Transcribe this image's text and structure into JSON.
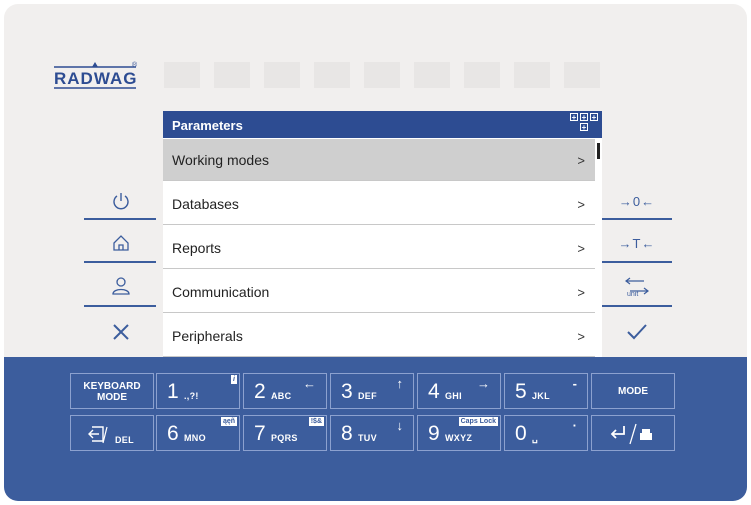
{
  "brand": {
    "logo_text": "RADWAG",
    "registered": "®"
  },
  "screen": {
    "title": "Parameters",
    "items": [
      {
        "label": "Working modes",
        "arrow": ">",
        "selected": true
      },
      {
        "label": "Databases",
        "arrow": ">",
        "selected": false
      },
      {
        "label": "Reports",
        "arrow": ">",
        "selected": false
      },
      {
        "label": "Communication",
        "arrow": ">",
        "selected": false
      },
      {
        "label": "Peripherals",
        "arrow": ">",
        "selected": false
      }
    ]
  },
  "right_buttons": {
    "zero": "→0←",
    "tare": "→T←",
    "unit": "unit"
  },
  "keypad": {
    "keyboard_mode": [
      "KEYBOARD",
      "MODE"
    ],
    "k1": {
      "big": "1",
      "small": ".,?!",
      "badge": "i"
    },
    "k2": {
      "big": "2",
      "small": "ABC",
      "corner": "←"
    },
    "k3": {
      "big": "3",
      "small": "DEF",
      "corner": "↑"
    },
    "k4": {
      "big": "4",
      "small": "GHI",
      "corner": "→"
    },
    "k5": {
      "big": "5",
      "small": "JKL",
      "corner": "-"
    },
    "mode": "MODE",
    "del": "DEL",
    "k6": {
      "big": "6",
      "small": "MNO",
      "badge": "ąęñ"
    },
    "k7": {
      "big": "7",
      "small": "PQRS",
      "badge": "!$&"
    },
    "k8": {
      "big": "8",
      "small": "TUV",
      "corner": "↓"
    },
    "k9": {
      "big": "9",
      "small": "WXYZ",
      "badge": "Caps Lock"
    },
    "k0": {
      "big": "0",
      "small": "␣",
      "corner": "·"
    }
  }
}
